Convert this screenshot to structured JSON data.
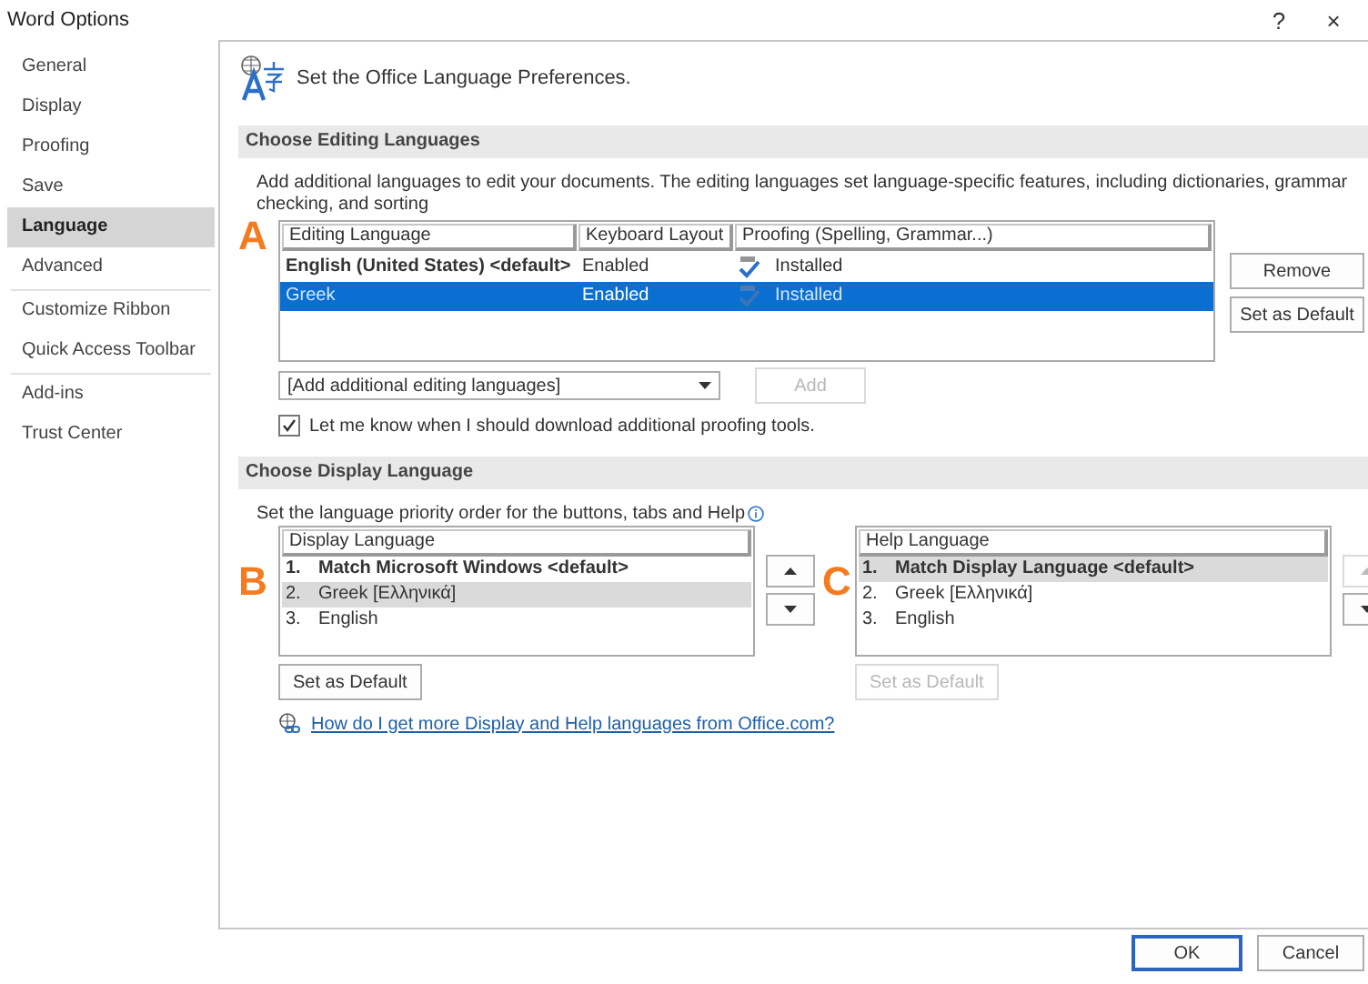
{
  "window": {
    "title": "Word Options",
    "help": "?",
    "close": "×"
  },
  "sidebar": {
    "groups": [
      [
        {
          "label": "General",
          "selected": false
        },
        {
          "label": "Display",
          "selected": false
        },
        {
          "label": "Proofing",
          "selected": false
        },
        {
          "label": "Save",
          "selected": false
        },
        {
          "label": "Language",
          "selected": true
        },
        {
          "label": "Advanced",
          "selected": false
        }
      ],
      [
        {
          "label": "Customize Ribbon",
          "selected": false
        },
        {
          "label": "Quick Access Toolbar",
          "selected": false
        }
      ],
      [
        {
          "label": "Add-ins",
          "selected": false
        },
        {
          "label": "Trust Center",
          "selected": false
        }
      ]
    ]
  },
  "header": "Set the Office Language Preferences.",
  "editing": {
    "title": "Choose Editing Languages",
    "description": "Add additional languages to edit your documents. The editing languages set language-specific features, including dictionaries, grammar checking, and sorting",
    "marker": "A",
    "columns": [
      "Editing Language",
      "Keyboard Layout",
      "Proofing (Spelling, Grammar...)"
    ],
    "rows": [
      {
        "language": "English (United States) <default>",
        "is_default": true,
        "keyboard": "Enabled",
        "proofing": "Installed",
        "selected": false
      },
      {
        "language": "Greek",
        "is_default": false,
        "keyboard": "Enabled",
        "proofing": "Installed",
        "selected": true
      }
    ],
    "buttons": [
      {
        "label": "Remove",
        "disabled": false
      },
      {
        "label": "Set as Default",
        "disabled": false
      }
    ],
    "dropdown": {
      "value": "[Add additional editing languages]"
    },
    "add_button": {
      "label": "Add",
      "disabled": true
    },
    "checkbox": {
      "label": "Let me know when I should download additional proofing tools.",
      "checked": true
    }
  },
  "display": {
    "title": "Choose Display Language",
    "hint": "Set the language priority order for the buttons, tabs and Help",
    "lists": [
      {
        "marker": "B",
        "header": "Display Language",
        "up_disabled": false,
        "down_disabled": false,
        "set_default": {
          "label": "Set as Default",
          "disabled": false
        },
        "items": [
          {
            "number": "1.",
            "label": "Match Microsoft Windows <default>",
            "is_default": true,
            "selected": false
          },
          {
            "number": "2.",
            "label": "Greek [Ελληνικά]",
            "is_default": false,
            "selected": true
          },
          {
            "number": "3.",
            "label": "English",
            "is_default": false,
            "selected": false
          }
        ]
      },
      {
        "marker": "C",
        "header": "Help Language",
        "up_disabled": true,
        "down_disabled": false,
        "set_default": {
          "label": "Set as Default",
          "disabled": true
        },
        "items": [
          {
            "number": "1.",
            "label": "Match Display Language <default>",
            "is_default": true,
            "selected": true
          },
          {
            "number": "2.",
            "label": "Greek [Ελληνικά]",
            "is_default": false,
            "selected": false
          },
          {
            "number": "3.",
            "label": "English",
            "is_default": false,
            "selected": false
          }
        ]
      }
    ],
    "link": "How do I get more Display and Help languages from Office.com?"
  },
  "footer": [
    {
      "label": "OK",
      "default": true
    },
    {
      "label": "Cancel",
      "default": false
    }
  ]
}
